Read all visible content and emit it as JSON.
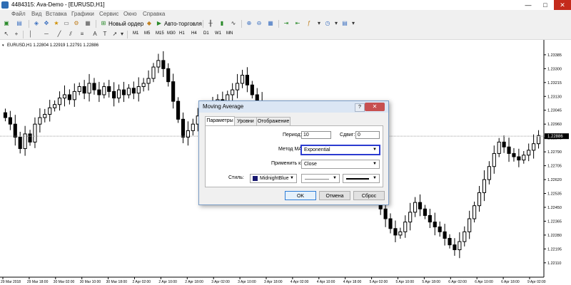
{
  "window": {
    "title": "4484315: Ava-Demo - [EURUSD,H1]",
    "controls": [
      "—",
      "□",
      "✕"
    ]
  },
  "menu": [
    "Файл",
    "Вид",
    "Вставка",
    "Графики",
    "Сервис",
    "Окно",
    "Справка"
  ],
  "toolbar": {
    "new_order": "Новый ордер",
    "auto_trading": "Авто-торговля",
    "timeframes": [
      "M1",
      "M5",
      "M15",
      "M30",
      "H1",
      "H4",
      "D1",
      "W1",
      "MN"
    ]
  },
  "chart": {
    "header": "EURUSD,H1  1.22804 1.22919 1.22791 1.22886",
    "current_price": "1.22886",
    "price_labels": [
      "1.23385",
      "1.23300",
      "1.23215",
      "1.23130",
      "1.23045",
      "1.22960",
      "1.22875",
      "1.22790",
      "1.22705",
      "1.22620",
      "1.22535",
      "1.22450",
      "1.22365",
      "1.22280",
      "1.22195",
      "1.22110"
    ],
    "time_labels": [
      "29 Mar 2018",
      "29 Mar 18:00",
      "30 Mar 02:00",
      "30 Mar 10:00",
      "30 Mar 18:00",
      "2 Apr 02:00",
      "2 Apr 10:00",
      "2 Apr 18:00",
      "3 Apr 02:00",
      "3 Apr 10:00",
      "3 Apr 18:00",
      "4 Apr 02:00",
      "4 Apr 10:00",
      "4 Apr 18:00",
      "5 Apr 02:00",
      "5 Apr 10:00",
      "5 Apr 18:00",
      "6 Apr 02:00",
      "6 Apr 10:00",
      "6 Apr 18:00",
      "9 Apr 02:00"
    ],
    "colors": {
      "candle": "#000000",
      "background": "#ffffff",
      "price_line": "#a0a0a0"
    }
  },
  "chart_data": {
    "type": "candlestick",
    "symbol": "EURUSD",
    "timeframe": "H1",
    "ylim": [
      1.2207,
      1.2345
    ],
    "last": {
      "open": 1.22804,
      "high": 1.22919,
      "low": 1.22791,
      "close": 1.22886
    },
    "closes": [
      1.23,
      1.2296,
      1.2288,
      1.2281,
      1.229,
      1.2285,
      1.2296,
      1.23,
      1.2302,
      1.2306,
      1.2308,
      1.2312,
      1.2314,
      1.2311,
      1.2316,
      1.2319,
      1.2315,
      1.2321,
      1.2317,
      1.2314,
      1.2319,
      1.2316,
      1.2312,
      1.2317,
      1.2314,
      1.2318,
      1.2315,
      1.2319,
      1.2321,
      1.2324,
      1.2331,
      1.2335,
      1.233,
      1.2322,
      1.231,
      1.2299,
      1.2288,
      1.2292,
      1.2296,
      1.2301,
      1.2299,
      1.2303,
      1.2307,
      1.2311,
      1.2309,
      1.2314,
      1.2317,
      1.2321,
      1.2326,
      1.232,
      1.2314,
      1.231,
      1.2305,
      1.23,
      1.2296,
      1.2292,
      1.229,
      1.2294,
      1.2298,
      1.2296,
      1.2292,
      1.2288,
      1.2285,
      1.2282,
      1.228,
      1.2284,
      1.2289,
      1.2286,
      1.2282,
      1.2278,
      1.2275,
      1.2272,
      1.2268,
      1.2262,
      1.2256,
      1.225,
      1.2244,
      1.2238,
      1.2232,
      1.2228,
      1.223,
      1.2236,
      1.2242,
      1.2248,
      1.2244,
      1.224,
      1.2236,
      1.2233,
      1.223,
      1.2226,
      1.2222,
      1.2219,
      1.2224,
      1.223,
      1.2238,
      1.2246,
      1.2254,
      1.2262,
      1.227,
      1.2278,
      1.2285,
      1.2282,
      1.2278,
      1.2276,
      1.2274,
      1.2277,
      1.228,
      1.2284,
      1.2289
    ]
  },
  "dialog": {
    "title": "Moving Average",
    "help": "?",
    "close": "✕",
    "tabs": [
      "Параметры",
      "Уровни",
      "Отображение"
    ],
    "period_label": "Период:",
    "period_value": "10",
    "shift_label": "Сдвиг:",
    "shift_value": "0",
    "method_label": "Метод МА:",
    "method_value": "Exponential",
    "apply_label": "Применить к:",
    "apply_value": "Close",
    "style_label": "Стиль:",
    "color_value": "MidnightBlue",
    "color_hex": "#191970",
    "ok": "OK",
    "cancel": "Отмена",
    "reset": "Сброс"
  }
}
